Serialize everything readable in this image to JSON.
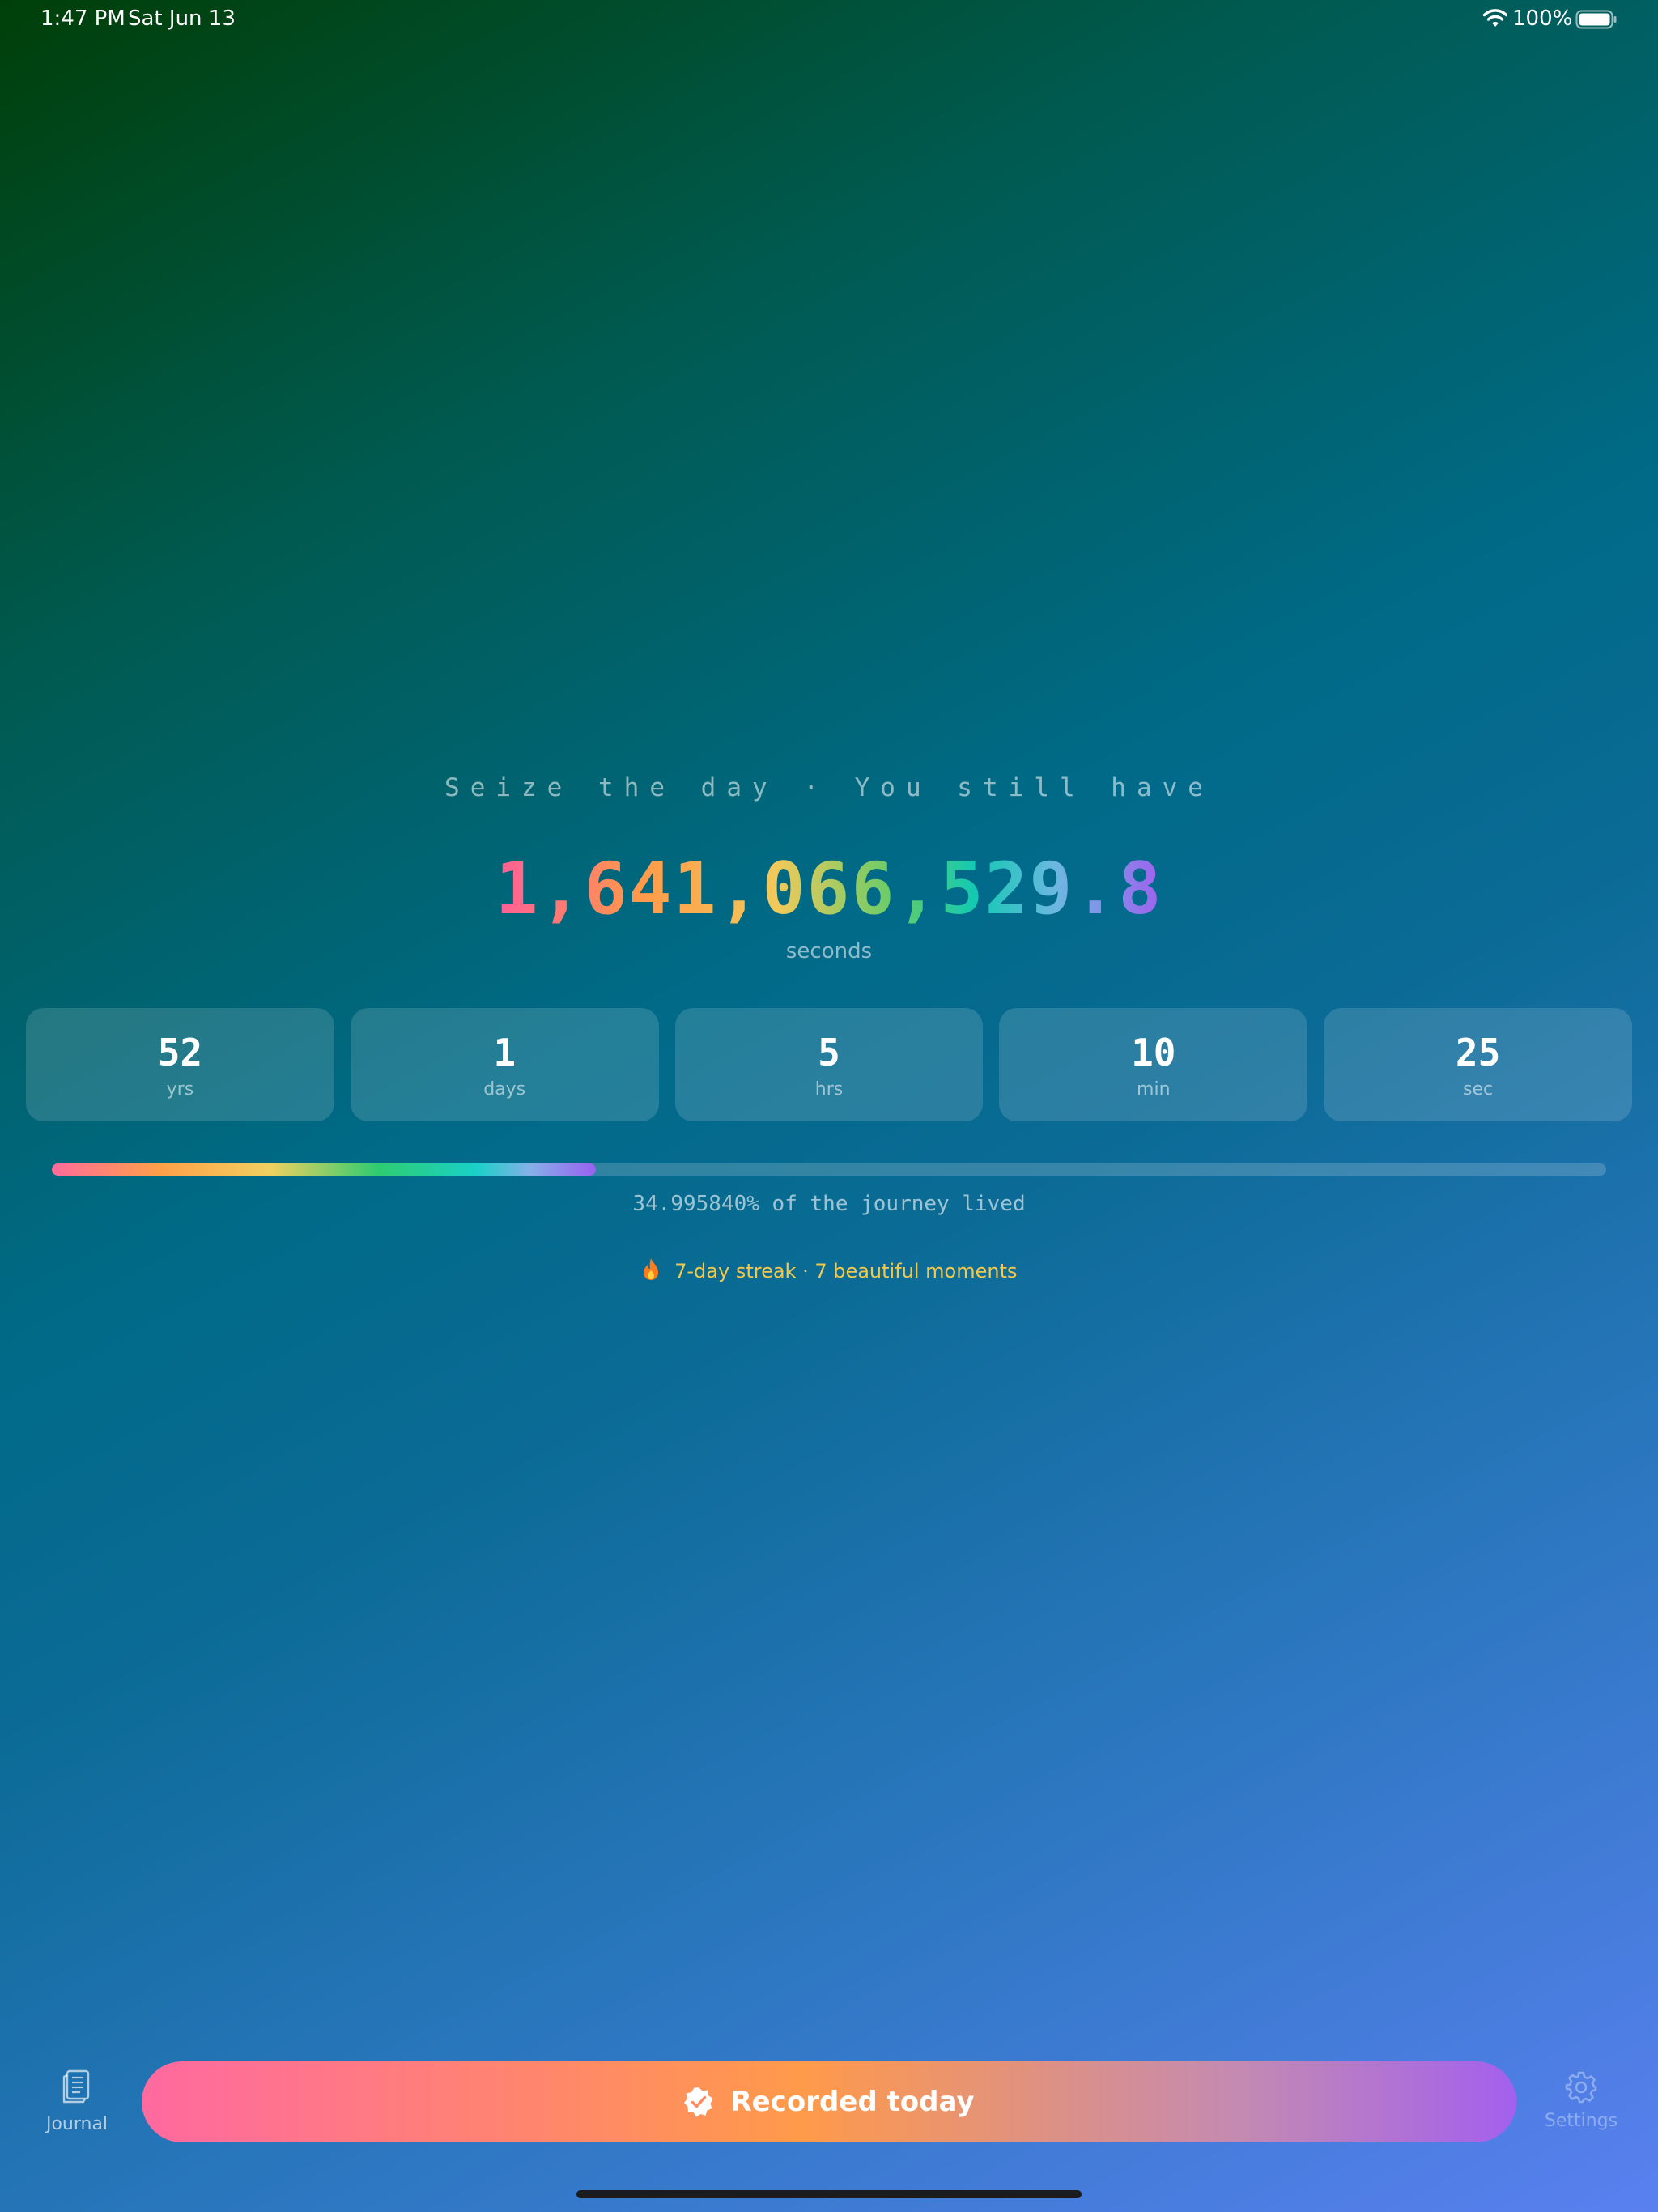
{
  "status_bar": {
    "time": "1:47 PM",
    "date": "Sat Jun 13",
    "battery": "100%",
    "wifi_icon": "wifi-icon",
    "battery_icon": "battery-icon"
  },
  "countdown": {
    "tagline": "Seize the day · You still have",
    "seconds_remaining": "1,641,066,529.8",
    "unit": "seconds"
  },
  "breakdown": [
    {
      "value": "52",
      "label": "yrs"
    },
    {
      "value": "1",
      "label": "days"
    },
    {
      "value": "5",
      "label": "hrs"
    },
    {
      "value": "10",
      "label": "min"
    },
    {
      "value": "25",
      "label": "sec"
    }
  ],
  "progress": {
    "percent": 34.99584,
    "text": "34.995840% of the journey lived"
  },
  "streak": {
    "icon": "fire-icon",
    "text": "7-day streak · 7 beautiful moments",
    "color": "#f2c94c"
  },
  "bottom_bar": {
    "journal_label": "Journal",
    "journal_icon": "journal-icon",
    "record_label": "Recorded today",
    "record_icon": "check-badge-icon",
    "settings_label": "Settings",
    "settings_icon": "gear-icon"
  },
  "colors": {
    "accent_gradient": [
      "#ff69a0",
      "#ff9a4a",
      "#a360ee"
    ],
    "background_top": "#003f08",
    "background_bottom": "#5a80f0"
  }
}
